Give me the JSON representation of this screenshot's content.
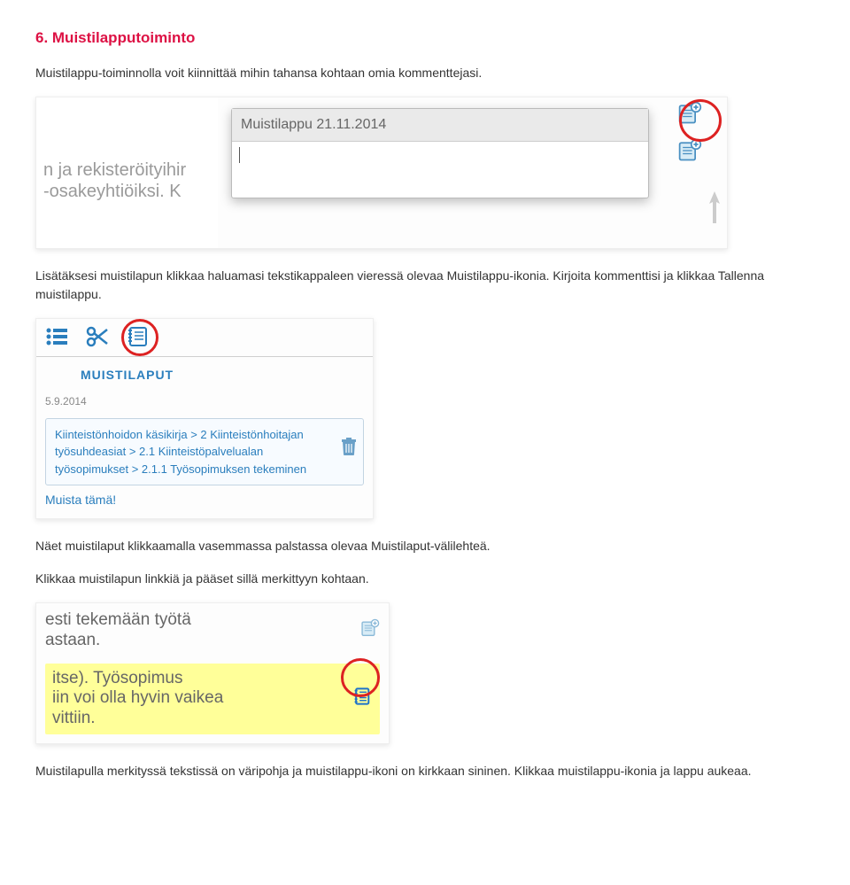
{
  "heading": "6.  Muistilapputoiminto",
  "intro": "Muistilappu-toiminnolla voit kiinnittää mihin tahansa kohtaan omia kommenttejasi.",
  "shot1": {
    "bg_text_line1": "n ja rekisteröityihir",
    "bg_text_line2": "-osakeyhtiöiksi. K",
    "panel_title": "Muistilappu 21.11.2014"
  },
  "para2a": "Lisätäksesi muistilapun klikkaa haluamasi tekstikappaleen vieressä olevaa Muistilappu-ikonia. Kirjoita kommenttisi ja klikkaa Tallenna muistilappu.",
  "shot2": {
    "heading": "MUISTILAPUT",
    "date": "5.9.2014",
    "path": "Kiinteistönhoidon käsikirja > 2 Kiinteistönhoitajan työsuhdeasiat > 2.1 Kiinteistöpalvelualan työsopimukset > 2.1.1 Työsopimuksen tekeminen",
    "muista": "Muista tämä!"
  },
  "para3": "Näet muistilaput klikkaamalla vasemmassa palstassa olevaa Muistilaput-välilehteä.",
  "para4": "Klikkaa muistilapun linkkiä ja pääset sillä merkittyyn kohtaan.",
  "shot3": {
    "row1_line1": "esti tekemään työtä",
    "row1_line2": "astaan.",
    "row2_line1": "itse). Työsopimus",
    "row2_line2": "iin voi olla hyvin vaikea",
    "row2_line3": "vittiin."
  },
  "para5": "Muistilapulla merkityssä tekstissä on väripohja ja muistilappu-ikoni on kirkkaan sininen. Klikkaa muistilappu-ikonia ja lappu aukeaa."
}
